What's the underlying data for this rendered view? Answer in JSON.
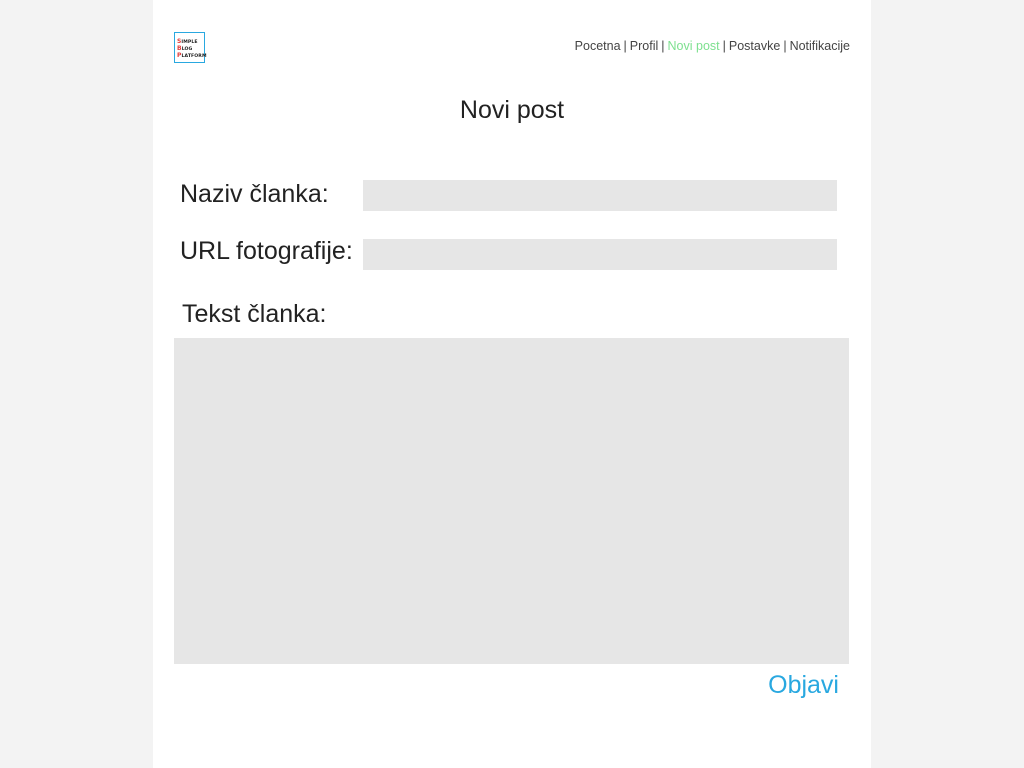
{
  "logo": {
    "line1_cap": "S",
    "line1_rest": "IMPLE",
    "line2_cap": "B",
    "line2_rest": "LOG",
    "line3_cap": "P",
    "line3_rest": "LATFORM"
  },
  "nav": {
    "items": [
      {
        "label": "Pocetna",
        "active": false
      },
      {
        "label": "Profil",
        "active": false
      },
      {
        "label": "Novi post",
        "active": true
      },
      {
        "label": "Postavke",
        "active": false
      },
      {
        "label": "Notifikacije",
        "active": false
      }
    ],
    "separator": "|"
  },
  "page_title": "Novi post",
  "form": {
    "title_label": "Naziv članka:",
    "title_value": "",
    "url_label": "URL fotografije:",
    "url_value": "",
    "text_label": "Tekst članka:",
    "text_value": "",
    "submit_label": "Objavi"
  },
  "colors": {
    "accent": "#29a8e0",
    "nav_active": "#7de08f",
    "field_bg": "#e6e6e6",
    "page_bg": "#f3f3f3"
  }
}
